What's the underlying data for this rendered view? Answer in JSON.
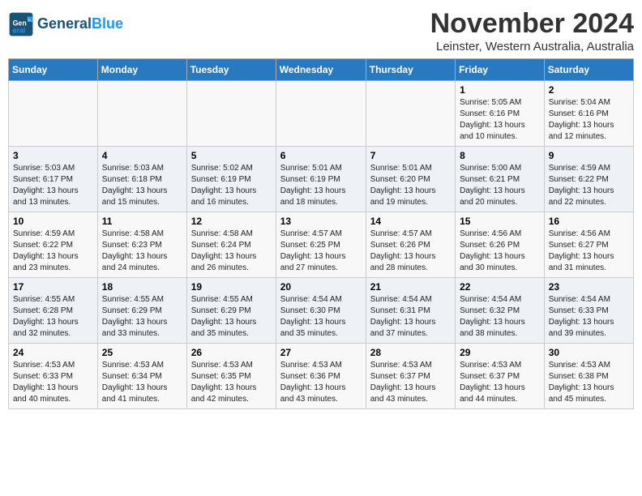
{
  "header": {
    "logo_line1": "General",
    "logo_line2": "Blue",
    "title": "November 2024",
    "subtitle": "Leinster, Western Australia, Australia"
  },
  "weekdays": [
    "Sunday",
    "Monday",
    "Tuesday",
    "Wednesday",
    "Thursday",
    "Friday",
    "Saturday"
  ],
  "weeks": [
    [
      {
        "day": "",
        "info": ""
      },
      {
        "day": "",
        "info": ""
      },
      {
        "day": "",
        "info": ""
      },
      {
        "day": "",
        "info": ""
      },
      {
        "day": "",
        "info": ""
      },
      {
        "day": "1",
        "info": "Sunrise: 5:05 AM\nSunset: 6:16 PM\nDaylight: 13 hours\nand 10 minutes."
      },
      {
        "day": "2",
        "info": "Sunrise: 5:04 AM\nSunset: 6:16 PM\nDaylight: 13 hours\nand 12 minutes."
      }
    ],
    [
      {
        "day": "3",
        "info": "Sunrise: 5:03 AM\nSunset: 6:17 PM\nDaylight: 13 hours\nand 13 minutes."
      },
      {
        "day": "4",
        "info": "Sunrise: 5:03 AM\nSunset: 6:18 PM\nDaylight: 13 hours\nand 15 minutes."
      },
      {
        "day": "5",
        "info": "Sunrise: 5:02 AM\nSunset: 6:19 PM\nDaylight: 13 hours\nand 16 minutes."
      },
      {
        "day": "6",
        "info": "Sunrise: 5:01 AM\nSunset: 6:19 PM\nDaylight: 13 hours\nand 18 minutes."
      },
      {
        "day": "7",
        "info": "Sunrise: 5:01 AM\nSunset: 6:20 PM\nDaylight: 13 hours\nand 19 minutes."
      },
      {
        "day": "8",
        "info": "Sunrise: 5:00 AM\nSunset: 6:21 PM\nDaylight: 13 hours\nand 20 minutes."
      },
      {
        "day": "9",
        "info": "Sunrise: 4:59 AM\nSunset: 6:22 PM\nDaylight: 13 hours\nand 22 minutes."
      }
    ],
    [
      {
        "day": "10",
        "info": "Sunrise: 4:59 AM\nSunset: 6:22 PM\nDaylight: 13 hours\nand 23 minutes."
      },
      {
        "day": "11",
        "info": "Sunrise: 4:58 AM\nSunset: 6:23 PM\nDaylight: 13 hours\nand 24 minutes."
      },
      {
        "day": "12",
        "info": "Sunrise: 4:58 AM\nSunset: 6:24 PM\nDaylight: 13 hours\nand 26 minutes."
      },
      {
        "day": "13",
        "info": "Sunrise: 4:57 AM\nSunset: 6:25 PM\nDaylight: 13 hours\nand 27 minutes."
      },
      {
        "day": "14",
        "info": "Sunrise: 4:57 AM\nSunset: 6:26 PM\nDaylight: 13 hours\nand 28 minutes."
      },
      {
        "day": "15",
        "info": "Sunrise: 4:56 AM\nSunset: 6:26 PM\nDaylight: 13 hours\nand 30 minutes."
      },
      {
        "day": "16",
        "info": "Sunrise: 4:56 AM\nSunset: 6:27 PM\nDaylight: 13 hours\nand 31 minutes."
      }
    ],
    [
      {
        "day": "17",
        "info": "Sunrise: 4:55 AM\nSunset: 6:28 PM\nDaylight: 13 hours\nand 32 minutes."
      },
      {
        "day": "18",
        "info": "Sunrise: 4:55 AM\nSunset: 6:29 PM\nDaylight: 13 hours\nand 33 minutes."
      },
      {
        "day": "19",
        "info": "Sunrise: 4:55 AM\nSunset: 6:29 PM\nDaylight: 13 hours\nand 35 minutes."
      },
      {
        "day": "20",
        "info": "Sunrise: 4:54 AM\nSunset: 6:30 PM\nDaylight: 13 hours\nand 35 minutes."
      },
      {
        "day": "21",
        "info": "Sunrise: 4:54 AM\nSunset: 6:31 PM\nDaylight: 13 hours\nand 37 minutes."
      },
      {
        "day": "22",
        "info": "Sunrise: 4:54 AM\nSunset: 6:32 PM\nDaylight: 13 hours\nand 38 minutes."
      },
      {
        "day": "23",
        "info": "Sunrise: 4:54 AM\nSunset: 6:33 PM\nDaylight: 13 hours\nand 39 minutes."
      }
    ],
    [
      {
        "day": "24",
        "info": "Sunrise: 4:53 AM\nSunset: 6:33 PM\nDaylight: 13 hours\nand 40 minutes."
      },
      {
        "day": "25",
        "info": "Sunrise: 4:53 AM\nSunset: 6:34 PM\nDaylight: 13 hours\nand 41 minutes."
      },
      {
        "day": "26",
        "info": "Sunrise: 4:53 AM\nSunset: 6:35 PM\nDaylight: 13 hours\nand 42 minutes."
      },
      {
        "day": "27",
        "info": "Sunrise: 4:53 AM\nSunset: 6:36 PM\nDaylight: 13 hours\nand 43 minutes."
      },
      {
        "day": "28",
        "info": "Sunrise: 4:53 AM\nSunset: 6:37 PM\nDaylight: 13 hours\nand 43 minutes."
      },
      {
        "day": "29",
        "info": "Sunrise: 4:53 AM\nSunset: 6:37 PM\nDaylight: 13 hours\nand 44 minutes."
      },
      {
        "day": "30",
        "info": "Sunrise: 4:53 AM\nSunset: 6:38 PM\nDaylight: 13 hours\nand 45 minutes."
      }
    ]
  ]
}
